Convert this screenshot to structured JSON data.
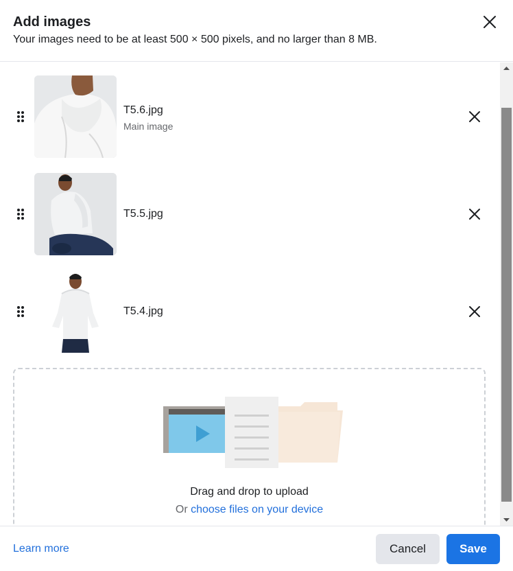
{
  "dialog": {
    "title": "Add images",
    "subtitle": "Your images need to be at least 500 × 500 pixels, and no larger than 8 MB."
  },
  "images": [
    {
      "filename": "T5.6.jpg",
      "label": "Main image"
    },
    {
      "filename": "T5.5.jpg",
      "label": ""
    },
    {
      "filename": "T5.4.jpg",
      "label": ""
    }
  ],
  "dropzone": {
    "drag_text": "Drag and drop to upload",
    "or_text": "Or",
    "choose_link": "choose files on your device"
  },
  "footer": {
    "learn_more": "Learn more",
    "cancel_label": "Cancel",
    "save_label": "Save"
  },
  "colors": {
    "accent": "#1b74e4",
    "link": "#216fdb",
    "secondary_button": "#e4e6eb"
  }
}
